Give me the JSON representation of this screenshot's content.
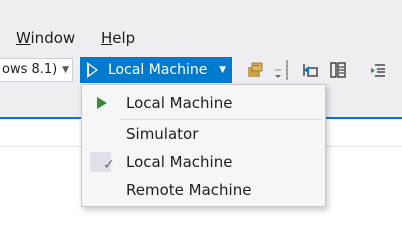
{
  "menubar": {
    "window_accel": "W",
    "window_rest": "indow",
    "help_accel": "H",
    "help_rest": "elp"
  },
  "toolbar": {
    "platform_value": "ows 8.1)",
    "run_target_label": "Local Machine",
    "accent": "#007acc"
  },
  "dropdown": {
    "header_label": "Local Machine",
    "items": [
      {
        "label": "Simulator",
        "checked": false
      },
      {
        "label": "Local Machine",
        "checked": true
      },
      {
        "label": "Remote Machine",
        "checked": false
      }
    ],
    "check_glyph": "✓"
  }
}
